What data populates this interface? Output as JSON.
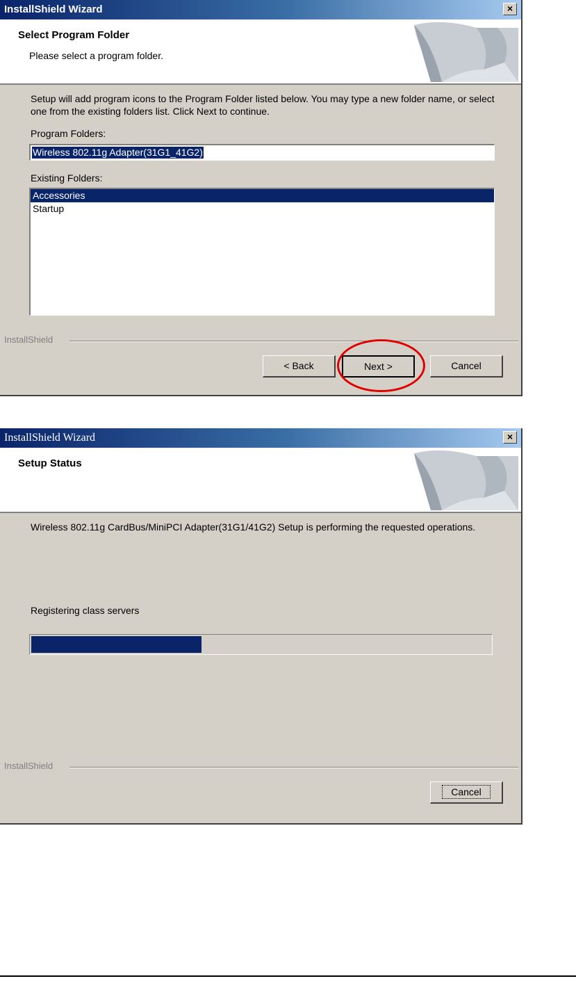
{
  "window1": {
    "title": "InstallShield Wizard",
    "close": "✕",
    "header_title": "Select Program Folder",
    "header_subtitle": "Please select a program folder.",
    "description": "Setup will add program icons to the Program Folder listed below.  You may type a new folder name, or select one from the existing folders list.  Click Next to continue.",
    "program_folders_label": "Program Folders:",
    "program_folder_value": "Wireless 802.11g Adapter(31G1_41G2)",
    "existing_folders_label": "Existing Folders:",
    "existing_folders": [
      "Accessories",
      "Startup"
    ],
    "selected_folder": "Accessories",
    "brand": "InstallShield",
    "buttons": {
      "back": "< Back",
      "next": "Next >",
      "cancel": "Cancel"
    }
  },
  "window2": {
    "title": "InstallShield Wizard",
    "close": "✕",
    "header_title": "Setup Status",
    "description": "Wireless 802.11g CardBus/MiniPCI Adapter(31G1/41G2) Setup is performing the requested operations.",
    "status_text": "Registering class servers",
    "progress": 0.37,
    "brand": "InstallShield",
    "buttons": {
      "cancel": "Cancel"
    }
  },
  "colors": {
    "titlebar": "#0a246a",
    "selection": "#0a246a",
    "dialog_bg": "#d4d0c8",
    "highlight_circle": "#e00000"
  }
}
